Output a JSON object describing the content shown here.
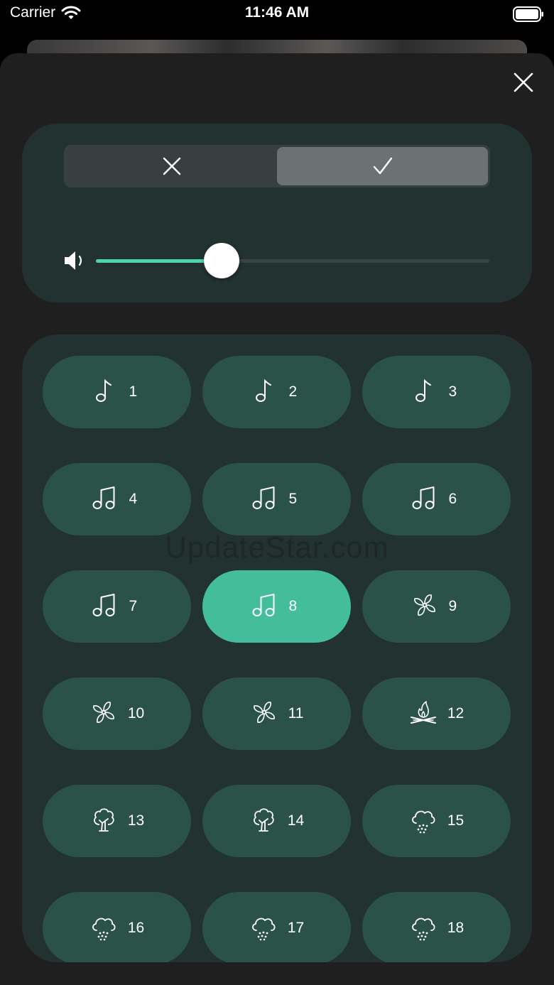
{
  "status_bar": {
    "carrier": "Carrier",
    "time": "11:46 AM"
  },
  "sheet": {
    "close_icon": "close-icon",
    "segmented": [
      {
        "icon": "x-icon",
        "selected": false
      },
      {
        "icon": "checkmark-icon",
        "selected": true
      }
    ],
    "volume": {
      "icon": "speaker-icon",
      "level": 0.32
    }
  },
  "sounds": [
    {
      "label": "1",
      "icon": "note-icon",
      "active": false
    },
    {
      "label": "2",
      "icon": "note-icon",
      "active": false
    },
    {
      "label": "3",
      "icon": "note-icon",
      "active": false
    },
    {
      "label": "4",
      "icon": "notes-icon",
      "active": false
    },
    {
      "label": "5",
      "icon": "notes-icon",
      "active": false
    },
    {
      "label": "6",
      "icon": "notes-icon",
      "active": false
    },
    {
      "label": "7",
      "icon": "notes-icon",
      "active": false
    },
    {
      "label": "8",
      "icon": "notes-icon",
      "active": true
    },
    {
      "label": "9",
      "icon": "fan-icon",
      "active": false
    },
    {
      "label": "10",
      "icon": "fan-icon",
      "active": false
    },
    {
      "label": "11",
      "icon": "fan-icon",
      "active": false
    },
    {
      "label": "12",
      "icon": "campfire-icon",
      "active": false
    },
    {
      "label": "13",
      "icon": "tree-icon",
      "active": false
    },
    {
      "label": "14",
      "icon": "tree-icon",
      "active": false
    },
    {
      "label": "15",
      "icon": "rain-cloud-icon",
      "active": false
    },
    {
      "label": "16",
      "icon": "rain-cloud-icon",
      "active": false
    },
    {
      "label": "17",
      "icon": "rain-cloud-icon",
      "active": false
    },
    {
      "label": "18",
      "icon": "rain-cloud-icon",
      "active": false
    }
  ],
  "colors": {
    "accent": "#44bd9d",
    "slider_fill": "#4ed4b0",
    "button": "#2b5248",
    "panel": "#223230",
    "sheet": "#1f1f1f"
  },
  "watermark": "UpdateStar.com"
}
